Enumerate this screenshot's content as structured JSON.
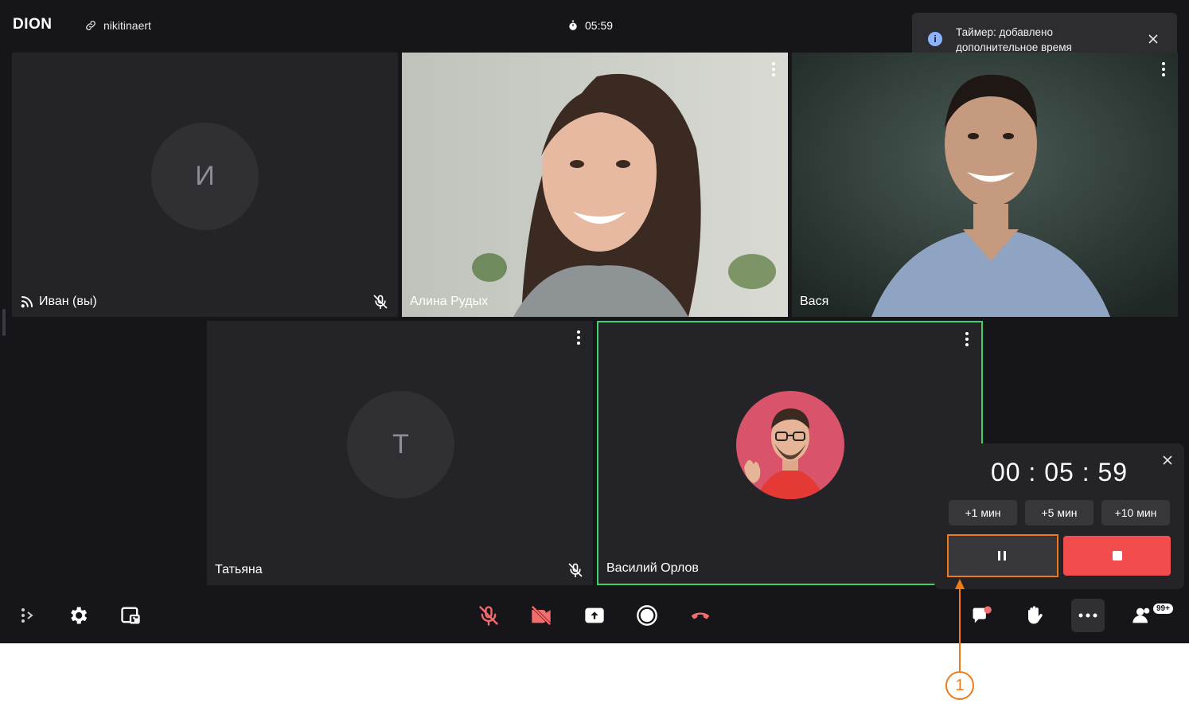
{
  "header": {
    "logo": "DION",
    "room_link": "nikitinaert",
    "meeting_time": "05:59"
  },
  "toast": {
    "line1": "Таймер: добавлено",
    "line2": "дополнительное время"
  },
  "participants": [
    {
      "name": "Иван (вы)",
      "initial": "И",
      "muted": true
    },
    {
      "name": "Алина Рудых",
      "muted": false
    },
    {
      "name": "Вася",
      "muted": false
    },
    {
      "name": "Татьяна",
      "initial": "Т",
      "muted": true
    },
    {
      "name": "Василий Орлов",
      "muted": false,
      "speaking": true
    }
  ],
  "timer_panel": {
    "time": "00 : 05 : 59",
    "add_buttons": [
      "+1 мин",
      "+5 мин",
      "+10 мин"
    ]
  },
  "toolbar": {
    "participants_badge": "99+"
  },
  "annotation": {
    "callout_number": "1"
  },
  "colors": {
    "background": "#16161a",
    "tile": "#242428",
    "accent_danger": "#f24c4c",
    "active_speaker_border": "#3fcf6b",
    "annotation": "#f07a1a"
  }
}
